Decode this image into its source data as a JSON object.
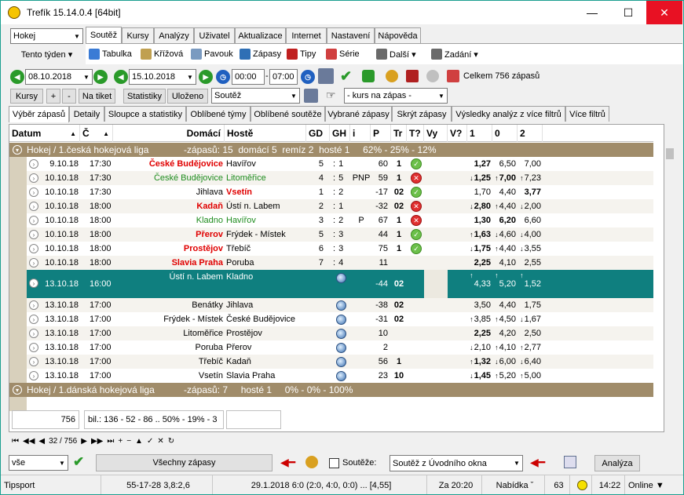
{
  "window": {
    "title": "Trefík 15.14.0.4 [64bit]",
    "minimize": "—",
    "maximize": "☐",
    "close": "✕"
  },
  "sport_select": "Hokej",
  "week_menu": "Tento týden ▾",
  "tabs": [
    "Soutěž",
    "Kursy",
    "Analýzy",
    "Uživatel",
    "Aktualizace",
    "Internet",
    "Nastavení",
    "Nápověda"
  ],
  "toolbar": [
    "Tabulka",
    "Křížová",
    "Pavouk",
    "Zápasy",
    "Tipy",
    "Série",
    "Další ▾",
    "Zadání ▾"
  ],
  "filter": {
    "date_from": "08.10.2018",
    "date_to": "15.10.2018",
    "time_from": "00:00",
    "time_to": "07:00",
    "total": "Celkem 756 zápasů"
  },
  "buttons": {
    "kursy": "Kursy",
    "plus": "+",
    "minus": "-",
    "na_tiket": "Na tiket",
    "statistiky": "Statistiky",
    "ulozeno": "Uloženo",
    "soutez": "Soutěž",
    "kurs_na_zapas": "- kurs na zápas -"
  },
  "subtabs": [
    "Výběr zápasů",
    "Detaily",
    "Sloupce a statistiky",
    "Oblíbené týmy",
    "Oblíbené soutěže",
    "Vybrané zápasy",
    "Skrýt zápasy",
    "Výsledky analýz z více filtrů",
    "Více filtrů"
  ],
  "headers": [
    "Datum",
    "Č",
    "Domácí",
    "Hostě",
    "GD",
    "GH",
    "i",
    "P",
    "Tr",
    "T?",
    "Vy",
    "V?",
    "1",
    "0",
    "2"
  ],
  "groups": [
    {
      "name": "Hokej / 1.česká hokejová liga",
      "stats": "-zápasů: 15  domácí 5  remíz 2  hosté 1     62% - 25% - 12%"
    },
    {
      "name": "Hokej / 1.dánská hokejová liga",
      "stats": "-zápasů: 7     hosté 1     0% - 0% - 100%"
    }
  ],
  "rows": [
    {
      "date": "9.10.18",
      "time": "17:30",
      "home": "České Budějovice",
      "away": "Havířov",
      "gd": "5",
      "gh": "1",
      "i": "",
      "p": "60",
      "tr": "1",
      "t": "ok",
      "o1": "1,27",
      "o0": "6,50",
      "o2": "7,00",
      "style": "home",
      "a1": "",
      "a0": "",
      "a2": ""
    },
    {
      "date": "10.10.18",
      "time": "17:30",
      "home": "České Budějovice",
      "away": "Litoměřice",
      "gd": "4",
      "gh": "5",
      "i": "PNP",
      "p": "59",
      "tr": "1",
      "t": "no",
      "o1": "1,25",
      "o0": "7,00",
      "o2": "7,23",
      "style": "green",
      "a1": "↓",
      "a0": "↑",
      "a2": "↑"
    },
    {
      "date": "10.10.18",
      "time": "17:30",
      "home": "Jihlava",
      "away": "Vsetín",
      "gd": "1",
      "gh": "2",
      "i": "",
      "p": "-17",
      "tr": "02",
      "t": "ok",
      "o1": "1,70",
      "o0": "4,40",
      "o2": "3,77",
      "style": "away",
      "a1": "",
      "a0": "",
      "a2": ""
    },
    {
      "date": "10.10.18",
      "time": "18:00",
      "home": "Kadaň",
      "away": "Ústí n. Labem",
      "gd": "2",
      "gh": "1",
      "i": "",
      "p": "-32",
      "tr": "02",
      "t": "no",
      "o1": "2,80",
      "o0": "4,40",
      "o2": "2,00",
      "style": "home",
      "a1": "↓",
      "a0": "↑",
      "a2": "↓"
    },
    {
      "date": "10.10.18",
      "time": "18:00",
      "home": "Kladno",
      "away": "Havířov",
      "gd": "3",
      "gh": "2",
      "i": "P",
      "p": "67",
      "tr": "1",
      "t": "no",
      "o1": "1,30",
      "o0": "6,20",
      "o2": "6,60",
      "style": "green",
      "a1": "",
      "a0": "",
      "a2": ""
    },
    {
      "date": "10.10.18",
      "time": "18:00",
      "home": "Přerov",
      "away": "Frýdek - Místek",
      "gd": "5",
      "gh": "3",
      "i": "",
      "p": "44",
      "tr": "1",
      "t": "ok",
      "o1": "1,63",
      "o0": "4,60",
      "o2": "4,00",
      "style": "home",
      "a1": "↑",
      "a0": "↓",
      "a2": "↓"
    },
    {
      "date": "10.10.18",
      "time": "18:00",
      "home": "Prostějov",
      "away": "Třebíč",
      "gd": "6",
      "gh": "3",
      "i": "",
      "p": "75",
      "tr": "1",
      "t": "ok",
      "o1": "1,75",
      "o0": "4,40",
      "o2": "3,55",
      "style": "home",
      "a1": "↓",
      "a0": "↑",
      "a2": "↓"
    },
    {
      "date": "10.10.18",
      "time": "18:00",
      "home": "Slavia Praha",
      "away": "Poruba",
      "gd": "7",
      "gh": "4",
      "i": "",
      "p": "11",
      "tr": "",
      "t": "",
      "o1": "2,25",
      "o0": "4,10",
      "o2": "2,55",
      "style": "home",
      "a1": "",
      "a0": "",
      "a2": ""
    },
    {
      "date": "13.10.18",
      "time": "16:00",
      "home": "Ústí n. Labem",
      "away": "Kladno",
      "gd": "",
      "gh": "globe",
      "i": "",
      "p": "-44",
      "tr": "02",
      "t": "",
      "o1": "4,33",
      "o0": "5,20",
      "o2": "1,52",
      "style": "sel",
      "a1": "↑",
      "a0": "↑",
      "a2": "↑"
    },
    {
      "date": "13.10.18",
      "time": "17:00",
      "home": "Benátky",
      "away": "Jihlava",
      "gd": "",
      "gh": "globe",
      "i": "",
      "p": "-38",
      "tr": "02",
      "t": "",
      "o1": "3,50",
      "o0": "4,40",
      "o2": "1,75",
      "style": "",
      "a1": "",
      "a0": "",
      "a2": ""
    },
    {
      "date": "13.10.18",
      "time": "17:00",
      "home": "Frýdek - Místek",
      "away": "České Budějovice",
      "gd": "",
      "gh": "globe",
      "i": "",
      "p": "-31",
      "tr": "02",
      "t": "",
      "o1": "3,85",
      "o0": "4,50",
      "o2": "1,67",
      "style": "",
      "a1": "↑",
      "a0": "↑",
      "a2": "↓"
    },
    {
      "date": "13.10.18",
      "time": "17:00",
      "home": "Litoměřice",
      "away": "Prostějov",
      "gd": "",
      "gh": "globe",
      "i": "",
      "p": "10",
      "tr": "",
      "t": "",
      "o1": "2,25",
      "o0": "4,20",
      "o2": "2,50",
      "style": "",
      "a1": "",
      "a0": "",
      "a2": ""
    },
    {
      "date": "13.10.18",
      "time": "17:00",
      "home": "Poruba",
      "away": "Přerov",
      "gd": "",
      "gh": "globe",
      "i": "",
      "p": "2",
      "tr": "",
      "t": "",
      "o1": "2,10",
      "o0": "4,10",
      "o2": "2,77",
      "style": "",
      "a1": "↓",
      "a0": "↑",
      "a2": "↑"
    },
    {
      "date": "13.10.18",
      "time": "17:00",
      "home": "Třebíč",
      "away": "Kadaň",
      "gd": "",
      "gh": "globe",
      "i": "",
      "p": "56",
      "tr": "1",
      "t": "",
      "o1": "1,32",
      "o0": "6,00",
      "o2": "6,40",
      "style": "",
      "a1": "↑",
      "a0": "↓",
      "a2": "↓"
    },
    {
      "date": "13.10.18",
      "time": "17:00",
      "home": "Vsetín",
      "away": "Slavia Praha",
      "gd": "",
      "gh": "globe",
      "i": "",
      "p": "23",
      "tr": "10",
      "t": "",
      "o1": "1,45",
      "o0": "5,20",
      "o2": "5,00",
      "style": "",
      "a1": "↓",
      "a0": "↑",
      "a2": "↑"
    }
  ],
  "summary": {
    "count": "756",
    "bil": "bil.: 136 - 52 - 86 .. 50% - 19% - 3"
  },
  "nav": {
    "pos": "32 / 756"
  },
  "bottom": {
    "vse": "vše",
    "vsechny": "Všechny zápasy",
    "souteze": "Soutěže:",
    "soutez_z": "Soutěž z Úvodního okna",
    "analyza": "Analýza"
  },
  "status": [
    "Tipsport",
    "55-17-28  3,8:2,6",
    "29.1.2018 6:0 (2:0, 4:0, 0:0) ... [4,55]",
    "Za 20:20",
    "Nabídka ˇ",
    "63",
    "14:22",
    "Online ▼"
  ],
  "colors": {
    "accent": "#0f7f7f",
    "group": "#a08c6a",
    "home_highlight": "#e00000",
    "green_text": "#1e8c1e"
  }
}
